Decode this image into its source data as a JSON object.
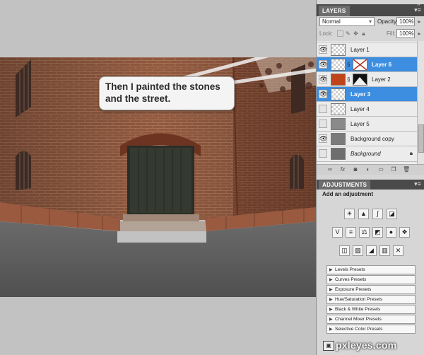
{
  "caption": {
    "line1": "Then I painted the stones",
    "line2": "and the street."
  },
  "layers_panel": {
    "tab": "LAYERS",
    "menu_icon": "panel-menu-icon",
    "blend_mode": "Normal",
    "opacity_label": "Opacity:",
    "opacity_value": "100%",
    "lock_label": "Lock:",
    "fill_label": "Fill:",
    "fill_value": "100%",
    "layers": [
      {
        "name": "Layer 1",
        "visible": true,
        "selected": false
      },
      {
        "name": "Layer 6",
        "visible": true,
        "selected": true
      },
      {
        "name": "Layer 2",
        "visible": true,
        "selected": false
      },
      {
        "name": "Layer 3",
        "visible": true,
        "selected": true
      },
      {
        "name": "Layer 4",
        "visible": false,
        "selected": false
      },
      {
        "name": "Layer 5",
        "visible": false,
        "selected": false
      },
      {
        "name": "Background copy",
        "visible": true,
        "selected": false
      },
      {
        "name": "Background",
        "visible": false,
        "selected": false,
        "locked": true
      }
    ]
  },
  "adjustments_panel": {
    "tab": "ADJUSTMENTS",
    "heading": "Add an adjustment",
    "presets": [
      "Levels Presets",
      "Curves Presets",
      "Exposure Presets",
      "Hue/Saturation Presets",
      "Black & White Presets",
      "Channel Mixer Presets",
      "Selective Color Presets"
    ]
  },
  "watermark": "pxleyes.com",
  "colors": {
    "selection": "#3d8ee0",
    "tab_bar": "#4a4a4a",
    "brick": "#8a4e35",
    "street": "#585858"
  }
}
